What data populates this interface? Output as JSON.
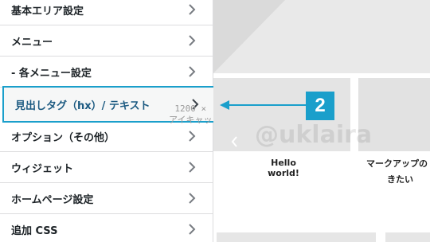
{
  "menu": {
    "items": [
      {
        "label": "基本エリア設定"
      },
      {
        "label": "メニュー"
      },
      {
        "label": "- 各メニュー設定"
      },
      {
        "label": "見出しタグ（hx）/ テキスト"
      },
      {
        "label": "オプション（その他）"
      },
      {
        "label": "ウィジェット"
      },
      {
        "label": "ホームページ設定"
      },
      {
        "label": "追加 CSS"
      }
    ]
  },
  "preview": {
    "thumb_size_label": "1200 ×",
    "thumb_caption_label": "アイキャッ",
    "post_title_1": "Hello world!",
    "post_title_2_line1": "マークアップの",
    "post_title_2_line2": "きたい",
    "watermark": "@ukl​aira"
  },
  "annotation": {
    "step_number": "2",
    "accent_color": "#1a9fcb"
  }
}
